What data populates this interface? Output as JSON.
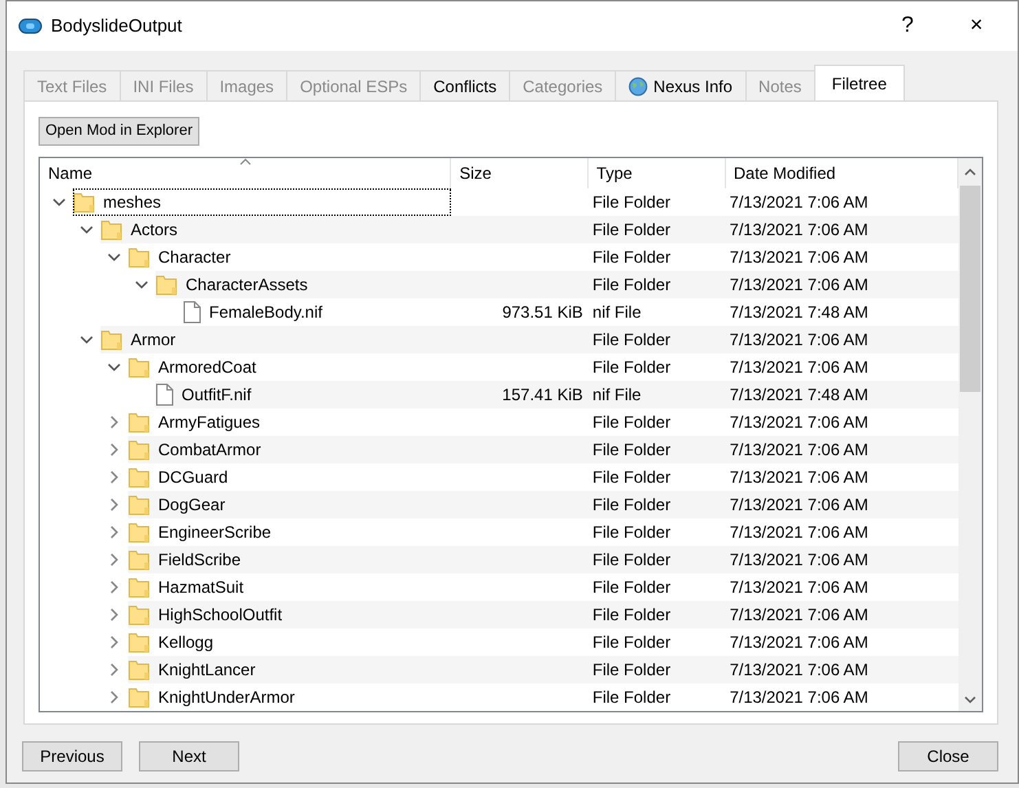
{
  "window": {
    "title": "BodyslideOutput",
    "help": "?",
    "close": "×"
  },
  "tabs": [
    {
      "label": "Text Files",
      "disabled": true,
      "selected": false
    },
    {
      "label": "INI Files",
      "disabled": true,
      "selected": false
    },
    {
      "label": "Images",
      "disabled": true,
      "selected": false
    },
    {
      "label": "Optional ESPs",
      "disabled": true,
      "selected": false
    },
    {
      "label": "Conflicts",
      "disabled": false,
      "selected": false
    },
    {
      "label": "Categories",
      "disabled": true,
      "selected": false
    },
    {
      "label": "Nexus Info",
      "disabled": false,
      "selected": false,
      "kind": "globe"
    },
    {
      "label": "Notes",
      "disabled": true,
      "selected": false
    },
    {
      "label": "Filetree",
      "disabled": false,
      "selected": true
    }
  ],
  "open_button": "Open Mod in Explorer",
  "tree": {
    "columns": [
      "Name",
      "Size",
      "Type",
      "Date Modified"
    ],
    "rows": [
      {
        "name": "meshes",
        "kind": "folder",
        "type": "File Folder",
        "date": "7/13/2021 7:06 AM",
        "expanded": true,
        "selected": true,
        "children": [
          {
            "name": "Actors",
            "kind": "folder",
            "type": "File Folder",
            "date": "7/13/2021 7:06 AM",
            "expanded": true,
            "selected": false,
            "children": [
              {
                "name": "Character",
                "kind": "folder",
                "type": "File Folder",
                "date": "7/13/2021 7:06 AM",
                "expanded": true,
                "selected": false,
                "children": [
                  {
                    "name": "CharacterAssets",
                    "kind": "folder",
                    "type": "File Folder",
                    "date": "7/13/2021 7:06 AM",
                    "expanded": true,
                    "selected": false,
                    "children": [
                      {
                        "name": "FemaleBody.nif",
                        "kind": "file",
                        "size": "973.51 KiB",
                        "type": "nif File",
                        "date": "7/13/2021 7:48 AM",
                        "selected": false
                      }
                    ]
                  }
                ]
              }
            ]
          },
          {
            "name": "Armor",
            "kind": "folder",
            "type": "File Folder",
            "date": "7/13/2021 7:06 AM",
            "expanded": true,
            "selected": false,
            "children": [
              {
                "name": "ArmoredCoat",
                "kind": "folder",
                "type": "File Folder",
                "date": "7/13/2021 7:06 AM",
                "expanded": true,
                "selected": false,
                "children": [
                  {
                    "name": "OutfitF.nif",
                    "kind": "file",
                    "size": "157.41 KiB",
                    "type": "nif File",
                    "date": "7/13/2021 7:48 AM",
                    "selected": false
                  }
                ]
              },
              {
                "name": "ArmyFatigues",
                "kind": "folder",
                "type": "File Folder",
                "date": "7/13/2021 7:06 AM",
                "expanded": false,
                "selected": false
              },
              {
                "name": "CombatArmor",
                "kind": "folder",
                "type": "File Folder",
                "date": "7/13/2021 7:06 AM",
                "expanded": false,
                "selected": false
              },
              {
                "name": "DCGuard",
                "kind": "folder",
                "type": "File Folder",
                "date": "7/13/2021 7:06 AM",
                "expanded": false,
                "selected": false
              },
              {
                "name": "DogGear",
                "kind": "folder",
                "type": "File Folder",
                "date": "7/13/2021 7:06 AM",
                "expanded": false,
                "selected": false
              },
              {
                "name": "EngineerScribe",
                "kind": "folder",
                "type": "File Folder",
                "date": "7/13/2021 7:06 AM",
                "expanded": false,
                "selected": false
              },
              {
                "name": "FieldScribe",
                "kind": "folder",
                "type": "File Folder",
                "date": "7/13/2021 7:06 AM",
                "expanded": false,
                "selected": false
              },
              {
                "name": "HazmatSuit",
                "kind": "folder",
                "type": "File Folder",
                "date": "7/13/2021 7:06 AM",
                "expanded": false,
                "selected": false
              },
              {
                "name": "HighSchoolOutfit",
                "kind": "folder",
                "type": "File Folder",
                "date": "7/13/2021 7:06 AM",
                "expanded": false,
                "selected": false
              },
              {
                "name": "Kellogg",
                "kind": "folder",
                "type": "File Folder",
                "date": "7/13/2021 7:06 AM",
                "expanded": false,
                "selected": false
              },
              {
                "name": "KnightLancer",
                "kind": "folder",
                "type": "File Folder",
                "date": "7/13/2021 7:06 AM",
                "expanded": false,
                "selected": false
              },
              {
                "name": "KnightUnderArmor",
                "kind": "folder",
                "type": "File Folder",
                "date": "7/13/2021 7:06 AM",
                "expanded": false,
                "selected": false
              }
            ]
          }
        ]
      }
    ]
  },
  "buttons": [
    "Previous",
    "Next",
    "Close"
  ]
}
